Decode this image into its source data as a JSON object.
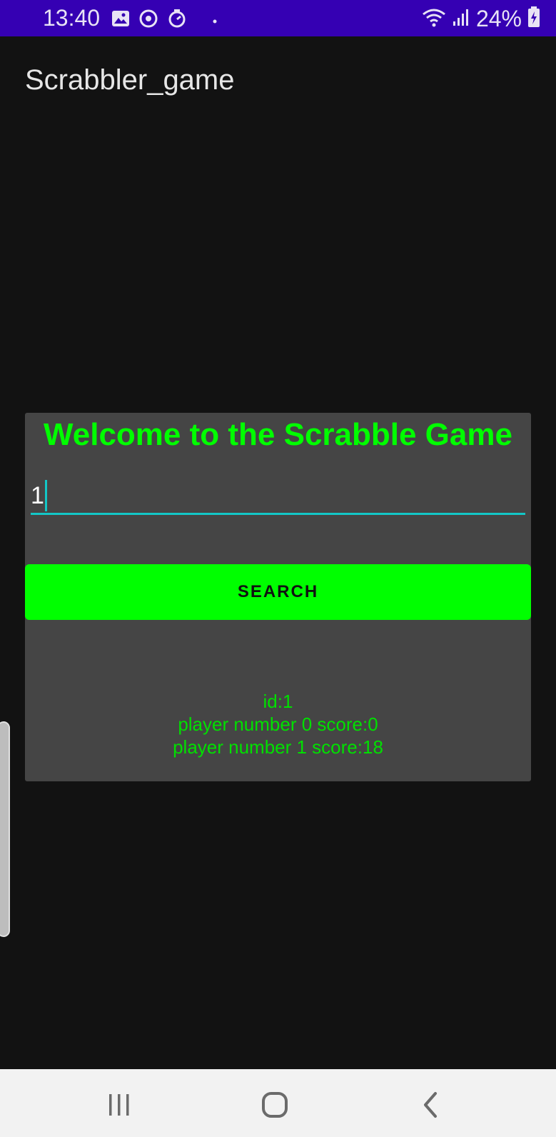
{
  "status_bar": {
    "time": "13:40",
    "battery": "24%",
    "icons_left": [
      "image-icon",
      "sync-icon",
      "timer-icon",
      "dot-icon"
    ],
    "icons_right": [
      "wifi-icon",
      "signal-icon",
      "battery-charging-icon"
    ]
  },
  "app": {
    "title": "Scrabbler_game"
  },
  "card": {
    "welcome": "Welcome to the Scrabble Game",
    "input_value": "1",
    "search_label": "SEARCH",
    "results": {
      "id_line": "id:1",
      "player0_line": "player number 0 score:0",
      "player1_line": "player number 1 score:18"
    }
  },
  "colors": {
    "status_bar": "#3500b3",
    "background": "#121212",
    "card": "#454545",
    "accent_green": "#00ff00",
    "input_underline": "#13c7c7"
  },
  "nav_bar": {
    "buttons": [
      "recent-apps-icon",
      "home-icon",
      "back-icon"
    ]
  }
}
